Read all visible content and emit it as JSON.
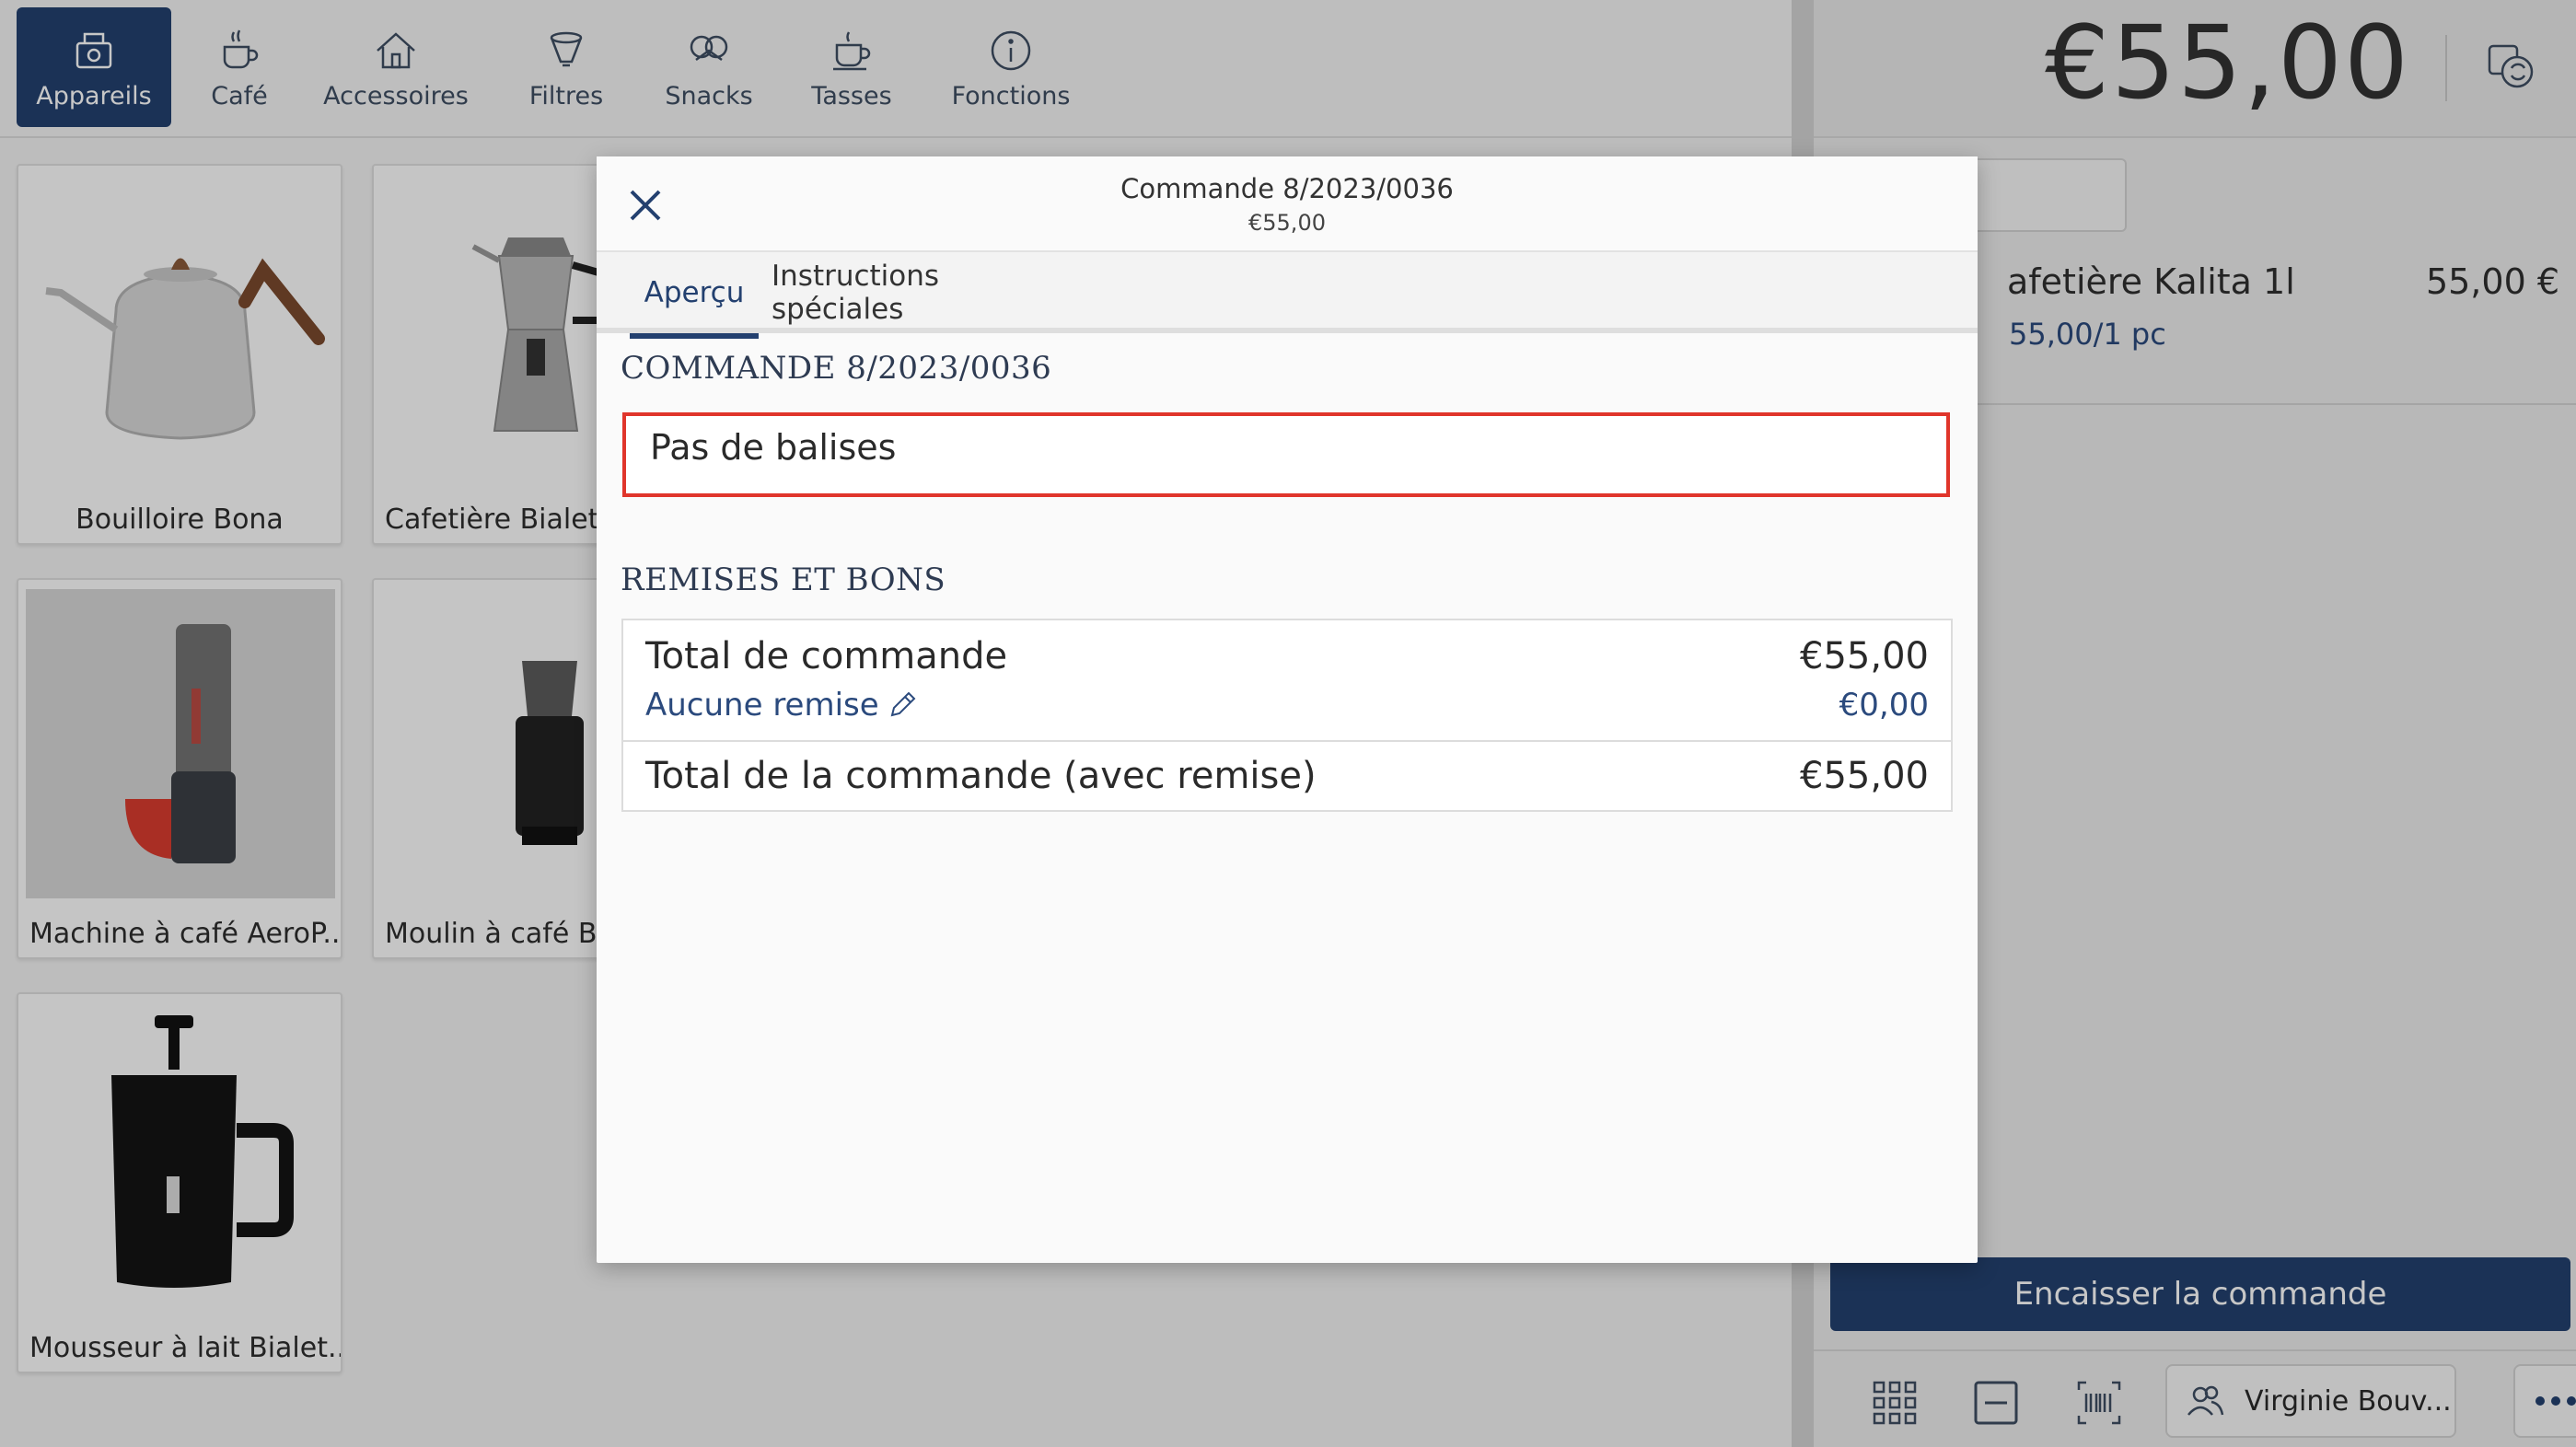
{
  "categories": [
    {
      "label": "Appareils",
      "icon": "appliance-icon",
      "active": true
    },
    {
      "label": "Café",
      "icon": "coffee-cup-icon"
    },
    {
      "label": "Accessoires",
      "icon": "home-icon"
    },
    {
      "label": "Filtres",
      "icon": "filter-icon"
    },
    {
      "label": "Snacks",
      "icon": "pretzel-icon"
    },
    {
      "label": "Tasses",
      "icon": "cup-icon"
    },
    {
      "label": "Fonctions",
      "icon": "info-icon"
    }
  ],
  "products": [
    {
      "label": "Bouilloire Bona"
    },
    {
      "label": "Cafetière Bialetti"
    },
    {
      "label": "Machine à café AeroP..."
    },
    {
      "label": "Moulin à café Bar"
    },
    {
      "label": "Mousseur à lait Bialet..."
    }
  ],
  "cart": {
    "total": "€55,00",
    "line": {
      "name": "afetière Kalita 1l",
      "price": "55,00 €",
      "unit": "55,00/1 pc"
    },
    "checkout_label": "Encaisser la commande",
    "customer": "Virginie Bouv..."
  },
  "modal": {
    "title": "Commande 8/2023/0036",
    "subtitle": "€55,00",
    "tabs": [
      {
        "label": "Aperçu",
        "active": true
      },
      {
        "label": "Instructions spéciales"
      }
    ],
    "order_heading": "COMMANDE 8/2023/0036",
    "tags_text": "Pas de balises",
    "discounts_heading": "REMISES ET BONS",
    "totals": {
      "order_total_label": "Total de commande",
      "order_total_value": "€55,00",
      "discount_label": "Aucune remise",
      "discount_value": "€0,00",
      "final_label": "Total de la commande (avec remise)",
      "final_value": "€55,00"
    }
  },
  "colors": {
    "brand": "#23406f",
    "link": "#2b4a7d",
    "highlight_border": "#e0352b"
  }
}
